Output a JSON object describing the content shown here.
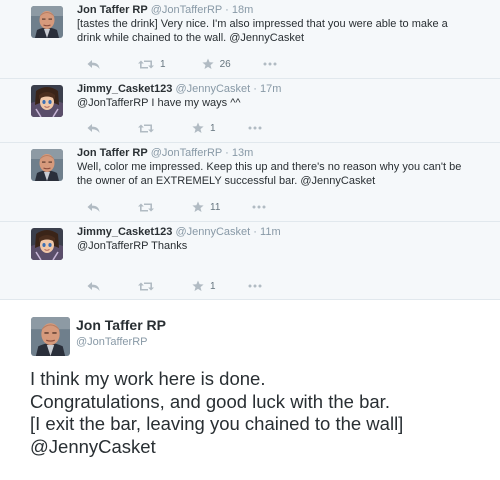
{
  "replies": [
    {
      "name": "Jon Taffer RP",
      "handle": "@JonTafferRP",
      "separator": "·",
      "time": "18m",
      "avatar": "jon-taffer",
      "lines": [
        "[tastes the drink] Very nice. I'm also impressed that you were able to make a",
        "drink while chained to the wall. @JennyCasket"
      ],
      "retweets": "1",
      "favorites": "26"
    },
    {
      "name": "Jimmy_Casket123",
      "handle": "@JennyCasket",
      "separator": "·",
      "time": "17m",
      "avatar": "jimmy-casket",
      "lines": [
        "@JonTafferRP I have my ways ^^"
      ],
      "retweets": "",
      "favorites": "1"
    },
    {
      "name": "Jon Taffer RP",
      "handle": "@JonTafferRP",
      "separator": "·",
      "time": "13m",
      "avatar": "jon-taffer",
      "lines": [
        "Well, color me impressed. Keep this up and there's no reason why you can't be",
        "the owner of an EXTREMELY successful bar. @JennyCasket"
      ],
      "retweets": "",
      "favorites": "11"
    },
    {
      "name": "Jimmy_Casket123",
      "handle": "@JennyCasket",
      "separator": "·",
      "time": "11m",
      "avatar": "jimmy-casket",
      "lines": [
        "@JonTafferRP Thanks"
      ],
      "retweets": "",
      "favorites": "1"
    }
  ],
  "main_tweet": {
    "name": "Jon Taffer RP",
    "handle": "@JonTafferRP",
    "avatar": "jon-taffer",
    "lines": [
      "I think my work here is done.",
      "Congratulations, and good luck with the bar.",
      "[I exit the bar, leaving you chained to the wall]",
      "@JennyCasket"
    ]
  },
  "icons": {
    "reply": "reply-icon",
    "retweet": "retweet-icon",
    "favorite": "star-icon",
    "more": "more-icon"
  },
  "colors": {
    "reply_background": "#f5f8fa",
    "divider": "#e1e8ed",
    "name": "#292f33",
    "secondary": "#8899a6",
    "icon": "#b1bbc3"
  }
}
